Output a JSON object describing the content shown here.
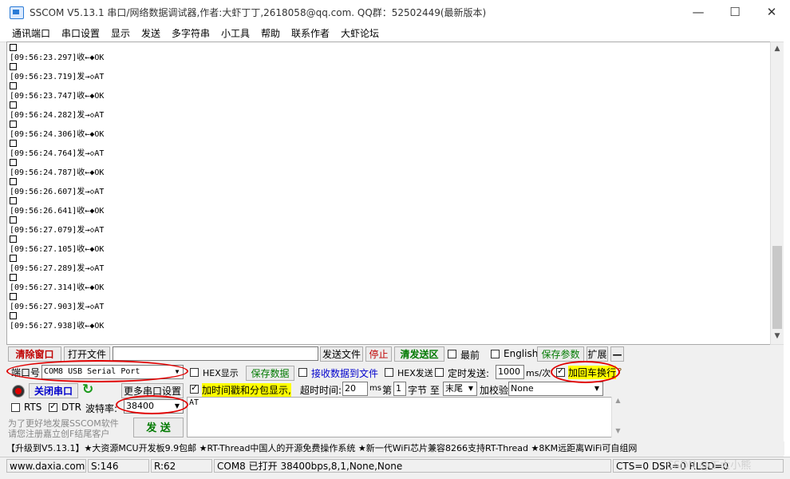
{
  "window": {
    "title": "SSCOM V5.13.1 串口/网络数据调试器,作者:大虾丁丁,2618058@qq.com. QQ群：52502449(最新版本)",
    "minimize": "—",
    "maximize": "☐",
    "close": "✕"
  },
  "menu": [
    "通讯端口",
    "串口设置",
    "显示",
    "发送",
    "多字符串",
    "小工具",
    "帮助",
    "联系作者",
    "大虾论坛"
  ],
  "log": [
    {
      "time": "[09:56:23.297]",
      "dir": "收←◆",
      "msg": "OK"
    },
    {
      "time": "[09:56:23.719]",
      "dir": "发→◇",
      "msg": "AT"
    },
    {
      "time": "[09:56:23.747]",
      "dir": "收←◆",
      "msg": "OK"
    },
    {
      "time": "[09:56:24.282]",
      "dir": "发→◇",
      "msg": "AT"
    },
    {
      "time": "[09:56:24.306]",
      "dir": "收←◆",
      "msg": "OK"
    },
    {
      "time": "[09:56:24.764]",
      "dir": "发→◇",
      "msg": "AT"
    },
    {
      "time": "[09:56:24.787]",
      "dir": "收←◆",
      "msg": "OK"
    },
    {
      "time": "[09:56:26.607]",
      "dir": "发→◇",
      "msg": "AT"
    },
    {
      "time": "[09:56:26.641]",
      "dir": "收←◆",
      "msg": "OK"
    },
    {
      "time": "[09:56:27.079]",
      "dir": "发→◇",
      "msg": "AT"
    },
    {
      "time": "[09:56:27.105]",
      "dir": "收←◆",
      "msg": "OK"
    },
    {
      "time": "[09:56:27.289]",
      "dir": "发→◇",
      "msg": "AT"
    },
    {
      "time": "[09:56:27.314]",
      "dir": "收←◆",
      "msg": "OK"
    },
    {
      "time": "[09:56:27.903]",
      "dir": "发→◇",
      "msg": "AT"
    },
    {
      "time": "[09:56:27.938]",
      "dir": "收←◆",
      "msg": "OK"
    }
  ],
  "toolbar": {
    "clear_window": "清除窗口",
    "open_file": "打开文件",
    "send_file": "发送文件",
    "stop": "停止",
    "clear_send": "清发送区",
    "frontmost": "最前",
    "english": "English",
    "save_params": "保存参数",
    "expand": "扩展",
    "collapse": "—"
  },
  "port": {
    "label": "端口号",
    "value": "COM8 USB Serial Port",
    "hex_display": "HEX显示",
    "save_data": "保存数据",
    "recv_to_file": "接收数据到文件",
    "hex_send": "HEX发送",
    "timed_send": "定时发送:",
    "interval": "1000",
    "interval_unit": "ms/次",
    "add_crlf": "加回车换行",
    "help": "?"
  },
  "controls": {
    "close_port": "关闭串口",
    "more_settings": "更多串口设置",
    "add_timestamp": "加时间戳和分包显示,",
    "timeout_label": "超时时间:",
    "timeout_value": "20",
    "timeout_unit": "ms",
    "byte_prefix": "第",
    "byte_value": "1",
    "byte_suffix": "字节 至",
    "end_value": "末尾",
    "checksum_label": "加校验",
    "checksum_value": "None",
    "rts": "RTS",
    "dtr": "DTR",
    "baud_label": "波特率:",
    "baud_value": "38400",
    "send": "发 送",
    "send_text": "AT",
    "promo_line1": "为了更好地发展SSCOM软件",
    "promo_line2": "请您注册嘉立创F结尾客户"
  },
  "promo_bar": "【升级到V5.13.1】★大资源MCU开发板9.9包邮 ★RT-Thread中国人的开源免费操作系统 ★新一代WiFi芯片兼容8266支持RT-Thread ★8KM远距离WiFi可自组网",
  "status": {
    "website": "www.daxia.com",
    "sent": "S:146",
    "received": "R:62",
    "port_info": "COM8 已打开  38400bps,8,1,None,None",
    "signals": "CTS=0 DSR=0 RLSD=0"
  },
  "watermark": "CSDN @工大小熊",
  "colors": {
    "red_annotation": "#e00000",
    "highlight": "#ffff00",
    "accent_blue": "#0000cc",
    "green_text": "#007a00"
  }
}
